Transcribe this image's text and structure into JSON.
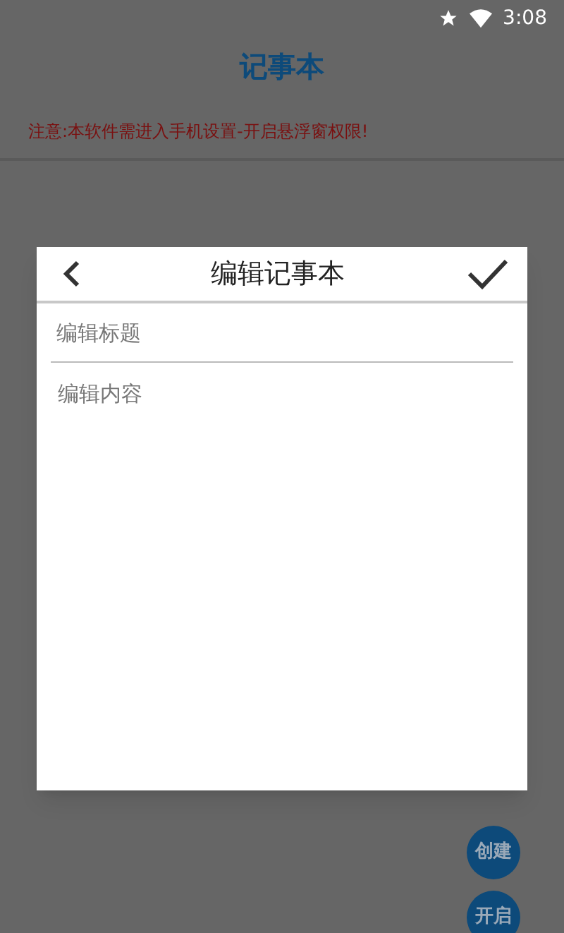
{
  "status_bar": {
    "time": "3:08"
  },
  "app": {
    "title": "记事本",
    "notice": "注意:本软件需进入手机设置-开启悬浮窗权限!"
  },
  "dialog": {
    "title": "编辑记事本",
    "title_field": {
      "placeholder": "编辑标题"
    },
    "content_field": {
      "placeholder": "编辑内容"
    }
  },
  "floating_buttons": [
    "创建",
    "开启"
  ]
}
